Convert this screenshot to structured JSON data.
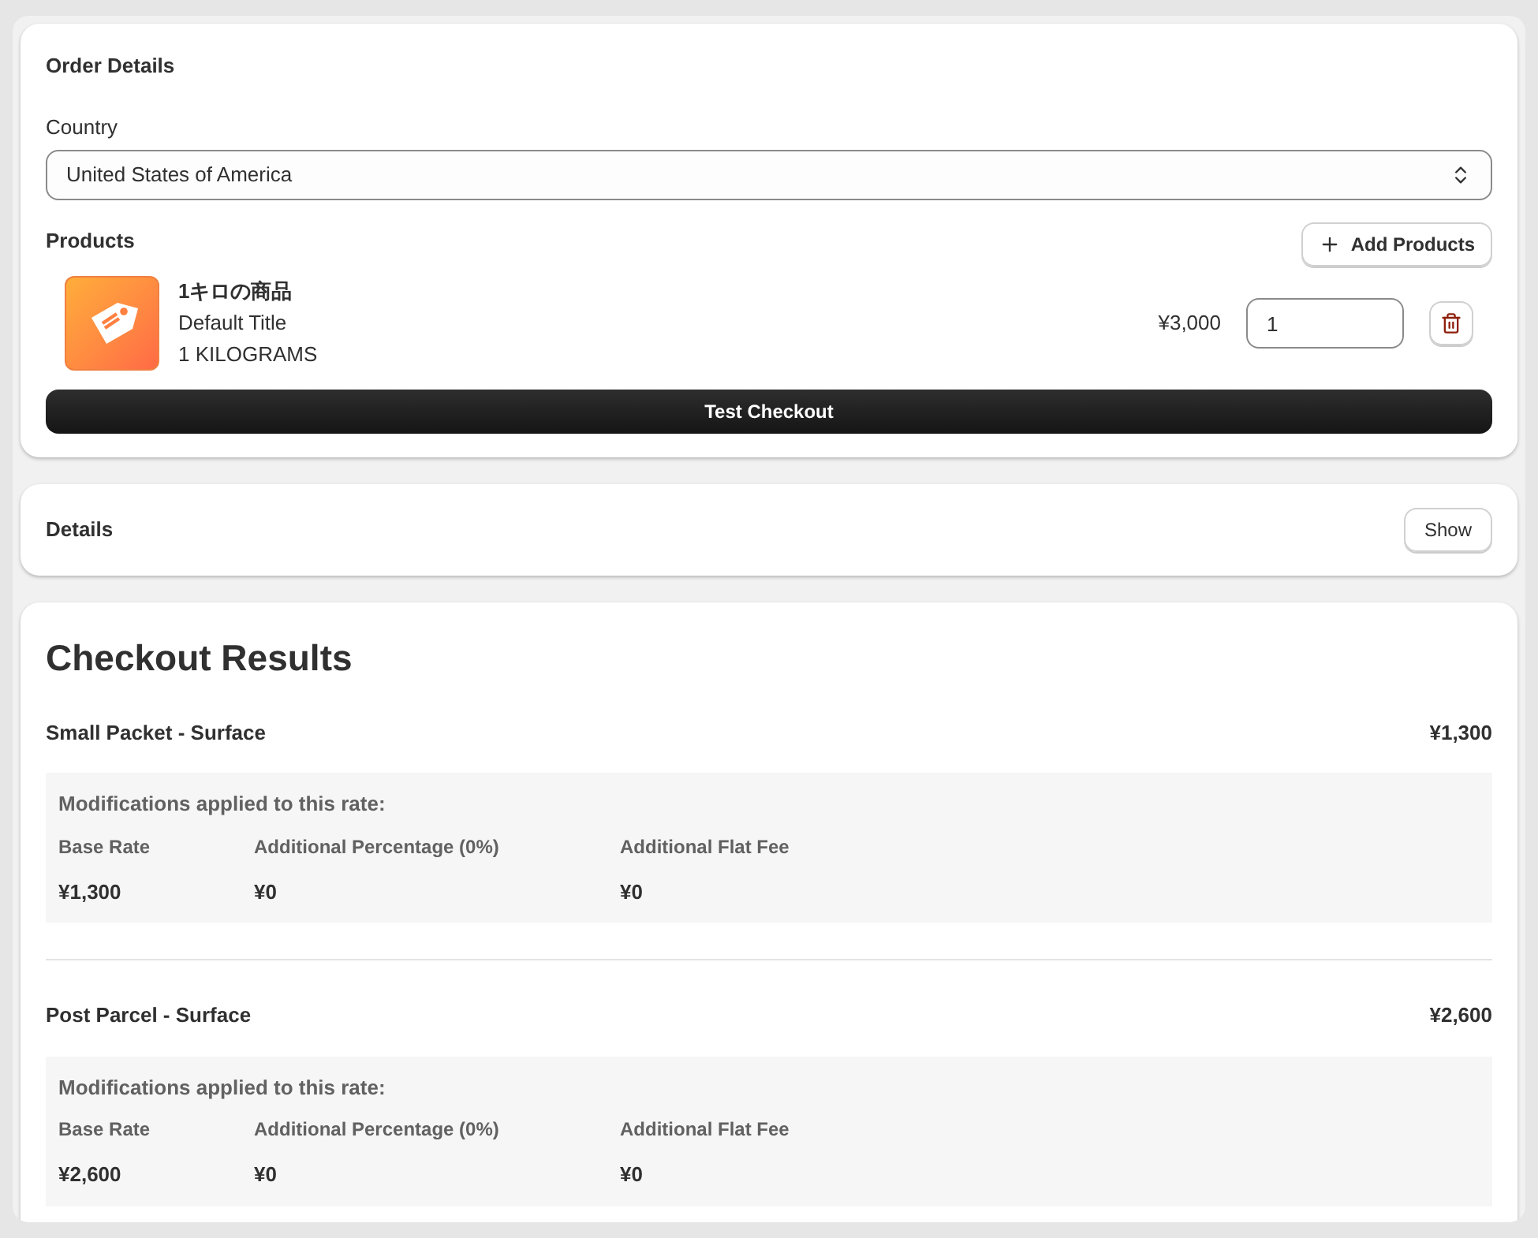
{
  "order_details": {
    "title": "Order Details",
    "country_label": "Country",
    "country_value": "United States of America",
    "products_label": "Products",
    "add_button": "Add Products",
    "products": [
      {
        "name": "1キロの商品",
        "variant": "Default Title",
        "weight": "1 KILOGRAMS",
        "price": "¥3,000",
        "quantity": "1"
      }
    ],
    "checkout_button": "Test Checkout"
  },
  "details": {
    "title": "Details",
    "button": "Show"
  },
  "results": {
    "title": "Checkout Results",
    "rates": [
      {
        "name": "Small Packet - Surface",
        "total": "¥1,300",
        "mod_title": "Modifications applied to this rate:",
        "columns": [
          {
            "label": "Base Rate",
            "value": "¥1,300"
          },
          {
            "label": "Additional Percentage (0%)",
            "value": "¥0"
          },
          {
            "label": "Additional Flat Fee",
            "value": "¥0"
          }
        ]
      },
      {
        "name": "Post Parcel - Surface",
        "total": "¥2,600",
        "mod_title": "Modifications applied to this rate:",
        "columns": [
          {
            "label": "Base Rate",
            "value": "¥2,600"
          },
          {
            "label": "Additional Percentage (0%)",
            "value": "¥0"
          },
          {
            "label": "Additional Flat Fee",
            "value": "¥0"
          }
        ]
      }
    ]
  }
}
